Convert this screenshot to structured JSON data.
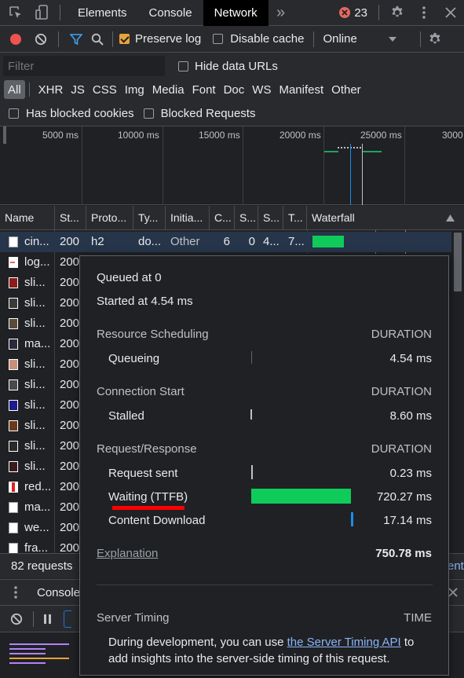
{
  "tabbar": {
    "tabs": [
      {
        "label": "Elements",
        "active": false
      },
      {
        "label": "Console",
        "active": false
      },
      {
        "label": "Network",
        "active": true
      }
    ],
    "more_label": "»",
    "error_count": "23",
    "icons": [
      "inspect-icon",
      "device-toggle-icon",
      "error-icon",
      "gear-icon",
      "kebab-menu-icon",
      "close-icon"
    ]
  },
  "toolbar": {
    "preserve_log_label": "Preserve log",
    "preserve_log_checked": true,
    "disable_cache_label": "Disable cache",
    "disable_cache_checked": false,
    "throttle_value": "Online"
  },
  "filter": {
    "placeholder": "Filter",
    "hide_data_urls_label": "Hide data URLs",
    "types": [
      "All",
      "XHR",
      "JS",
      "CSS",
      "Img",
      "Media",
      "Font",
      "Doc",
      "WS",
      "Manifest",
      "Other"
    ],
    "active_type": "All",
    "has_blocked_cookies_label": "Has blocked cookies",
    "blocked_requests_label": "Blocked Requests"
  },
  "overview": {
    "ticks": [
      "5000 ms",
      "10000 ms",
      "15000 ms",
      "20000 ms",
      "25000 ms",
      "3000"
    ]
  },
  "table": {
    "headers": [
      "Name",
      "St...",
      "Proto...",
      "Ty...",
      "Initia...",
      "C...",
      "S...",
      "S...",
      "T...",
      "Waterfall"
    ],
    "rows": [
      {
        "name": "cin...",
        "status": "200",
        "protocol": "h2",
        "type": "do...",
        "initiator": "Other",
        "c": "6",
        "s1": "0",
        "s2": "4...",
        "t": "7..."
      },
      {
        "name": "log...",
        "status": "200"
      },
      {
        "name": "sli...",
        "status": "200"
      },
      {
        "name": "sli...",
        "status": "200"
      },
      {
        "name": "sli...",
        "status": "200"
      },
      {
        "name": "ma...",
        "status": "200"
      },
      {
        "name": "sli...",
        "status": "200"
      },
      {
        "name": "sli...",
        "status": "200"
      },
      {
        "name": "sli...",
        "status": "200"
      },
      {
        "name": "sli...",
        "status": "200"
      },
      {
        "name": "sli...",
        "status": "200"
      },
      {
        "name": "sli...",
        "status": "200"
      },
      {
        "name": "red...",
        "status": "200"
      },
      {
        "name": "ma...",
        "status": "200"
      },
      {
        "name": "we...",
        "status": "200"
      },
      {
        "name": "fra...",
        "status": "200"
      }
    ]
  },
  "status": {
    "requests": "82 requests",
    "cut_text": "ent"
  },
  "drawer": {
    "tab_label": "Console"
  },
  "timing": {
    "queued_at": "Queued at 0",
    "started_at": "Started at 4.54 ms",
    "sections": [
      {
        "title": "Resource Scheduling",
        "col": "DURATION",
        "rows": [
          {
            "label": "Queueing",
            "value": "4.54 ms"
          }
        ]
      },
      {
        "title": "Connection Start",
        "col": "DURATION",
        "rows": [
          {
            "label": "Stalled",
            "value": "8.60 ms"
          }
        ]
      },
      {
        "title": "Request/Response",
        "col": "DURATION",
        "rows": [
          {
            "label": "Request sent",
            "value": "0.23 ms"
          },
          {
            "label": "Waiting (TTFB)",
            "value": "720.27 ms"
          },
          {
            "label": "Content Download",
            "value": "17.14 ms"
          }
        ]
      }
    ],
    "explanation_label": "Explanation",
    "total": "750.78 ms",
    "server_timing_title": "Server Timing",
    "server_timing_col": "TIME",
    "server_note_before": "During development, you can use ",
    "server_note_link": "the Server Timing API",
    "server_note_after": " to",
    "server_note_line2": "add insights into the server-side timing of this request."
  },
  "colors": {
    "ttfb_bar": "#0fcc5a",
    "download_bar": "#1a8ee8",
    "annotation_underline": "#ff0000",
    "record_button": "#ef5350",
    "preserve_checkbox": "#e8a33c"
  }
}
